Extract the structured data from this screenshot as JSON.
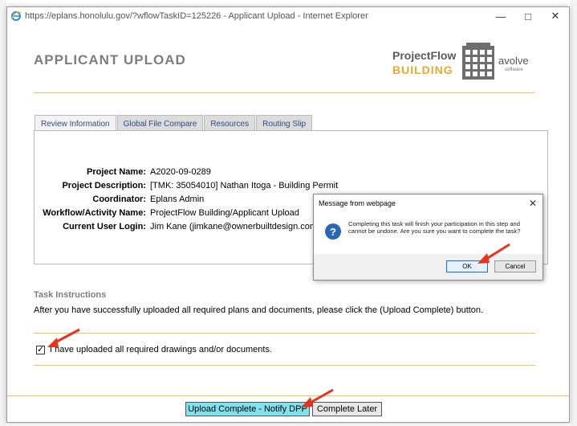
{
  "window": {
    "title": "https://eplans.honolulu.gov/?wflowTaskID=125226 - Applicant Upload - Internet Explorer",
    "controls": [
      "minimize-icon",
      "maximize-icon",
      "close-icon"
    ]
  },
  "header": {
    "title": "APPLICANT UPLOAD",
    "logo_line1": "ProjectFlow",
    "logo_line2": "BUILDING",
    "brand": "avolve",
    "brand_sub": "software"
  },
  "tabs": [
    {
      "label": "Review Information",
      "active": true
    },
    {
      "label": "Global File Compare",
      "active": false
    },
    {
      "label": "Resources",
      "active": false
    },
    {
      "label": "Routing Slip",
      "active": false
    }
  ],
  "info": [
    {
      "label": "Project Name:",
      "value": "A2020-09-0289"
    },
    {
      "label": "Project Description:",
      "value": "[TMK: 35054010] Nathan Itoga - Building Permit"
    },
    {
      "label": "Coordinator:",
      "value": "Eplans Admin"
    },
    {
      "label": "Workflow/Activity Name:",
      "value": "ProjectFlow Building/Applicant Upload"
    },
    {
      "label": "Current User Login:",
      "value": "Jim Kane (jimkane@ownerbuiltdesign.com)"
    }
  ],
  "task": {
    "title": "Task Instructions",
    "text": "After you have successfully uploaded all required plans and documents, please click the (Upload Complete) button.",
    "checkbox_label": "I have uploaded all required drawings and/or documents.",
    "checked": true
  },
  "buttons": {
    "primary": "Upload Complete - Notify DPP",
    "secondary": "Complete Later"
  },
  "dialog": {
    "title": "Message from webpage",
    "message": "Completing this task will finish your participation in this step and cannot be undone. Are you sure you want to complete the task?",
    "ok": "OK",
    "cancel": "Cancel",
    "icon": "question-icon"
  },
  "colors": {
    "accent": "#f2c25a",
    "primary_button": "#7fe3ef",
    "arrow": "#e8321e",
    "link": "#2c4d7a"
  }
}
